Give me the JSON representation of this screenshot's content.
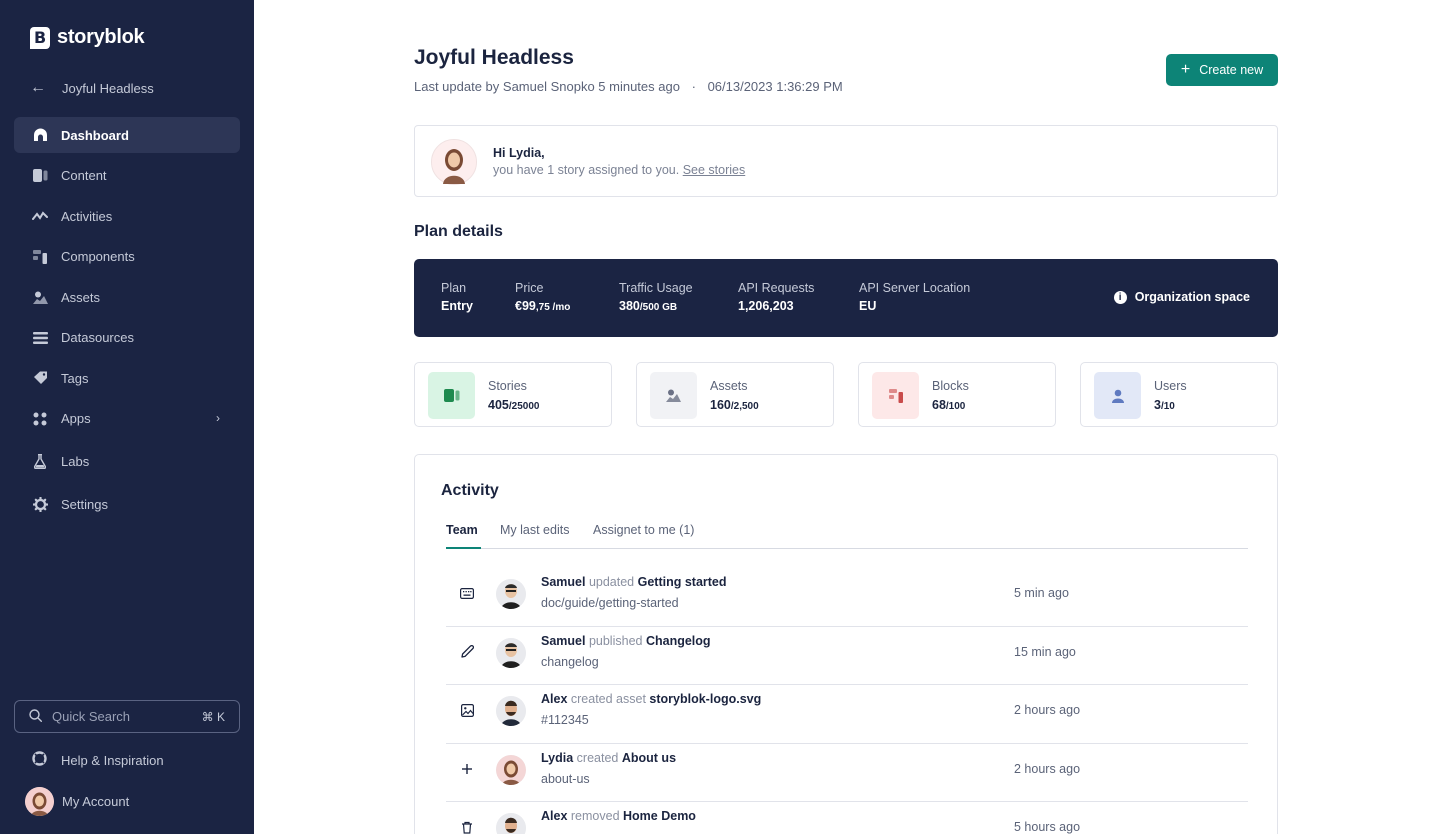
{
  "sidebar": {
    "logo_text": "storyblok",
    "space_name": "Joyful Headless",
    "nav": [
      {
        "label": "Dashboard",
        "icon": "dashboard-icon",
        "active": true
      },
      {
        "label": "Content",
        "icon": "content-icon"
      },
      {
        "label": "Activities",
        "icon": "activities-icon"
      },
      {
        "label": "Components",
        "icon": "components-icon"
      },
      {
        "label": "Assets",
        "icon": "assets-icon"
      },
      {
        "label": "Datasources",
        "icon": "datasources-icon"
      },
      {
        "label": "Tags",
        "icon": "tags-icon"
      },
      {
        "label": "Apps",
        "icon": "apps-icon"
      },
      {
        "label": "Labs",
        "icon": "labs-icon"
      },
      {
        "label": "Settings",
        "icon": "settings-icon"
      }
    ],
    "quick_search": {
      "placeholder": "Quick Search",
      "shortcut": "⌘ K"
    },
    "help_label": "Help & Inspiration",
    "account_label": "My Account"
  },
  "header": {
    "title": "Joyful Headless",
    "subtitle": "Last update by Samuel Snopko 5 minutes ago",
    "separator": "·",
    "timestamp": "06/13/2023 1:36:29 PM",
    "create_label": "Create new"
  },
  "greeting": {
    "hi": "Hi Lydia,",
    "message": "you have 1 story assigned to you.",
    "link": "See stories"
  },
  "plan": {
    "heading": "Plan details",
    "plan_label": "Plan",
    "plan_value": "Entry",
    "price_label": "Price",
    "price_value": "€99",
    "price_small": ",75 /mo",
    "traffic_label": "Traffic Usage",
    "traffic_value": "380",
    "traffic_small": "/500 GB",
    "api_label": "API Requests",
    "api_value": "1,206,203",
    "location_label": "API Server Location",
    "location_value": "EU",
    "org_label": "Organization space"
  },
  "stats": [
    {
      "label": "Stories",
      "value": "405",
      "max": "/25000",
      "color": "#d9f4e4",
      "fg": "#1e8a4f"
    },
    {
      "label": "Assets",
      "value": "160",
      "max": "/2,500",
      "color": "#f1f2f5",
      "fg": "#6b7185"
    },
    {
      "label": "Blocks",
      "value": "68",
      "max": "/100",
      "color": "#fde8e8",
      "fg": "#c94b4b"
    },
    {
      "label": "Users",
      "value": "3",
      "max": "/10",
      "color": "#e2e8f7",
      "fg": "#5f7ac0"
    }
  ],
  "activity": {
    "heading": "Activity",
    "tabs": [
      "Team",
      "My last edits",
      "Assignet to me (1)"
    ],
    "rows": [
      {
        "icon": "keyboard-icon",
        "who": "Samuel",
        "verb": "updated",
        "target": "Getting started",
        "detail": "doc/guide/getting-started",
        "time": "5 min ago"
      },
      {
        "icon": "pencil-icon",
        "who": "Samuel",
        "verb": "published",
        "target": "Changelog",
        "detail": "changelog",
        "time": "15 min ago"
      },
      {
        "icon": "image-icon",
        "who": "Alex",
        "verb": "created asset",
        "target": "storyblok-logo.svg",
        "detail": "#112345",
        "time": "2 hours ago"
      },
      {
        "icon": "plus-icon",
        "who": "Lydia",
        "verb": "created",
        "target": "About us",
        "detail": "about-us",
        "time": "2 hours ago"
      },
      {
        "icon": "trash-icon",
        "who": "Alex",
        "verb": "removed",
        "target": "Home Demo",
        "detail": "",
        "time": "5 hours ago"
      }
    ]
  }
}
